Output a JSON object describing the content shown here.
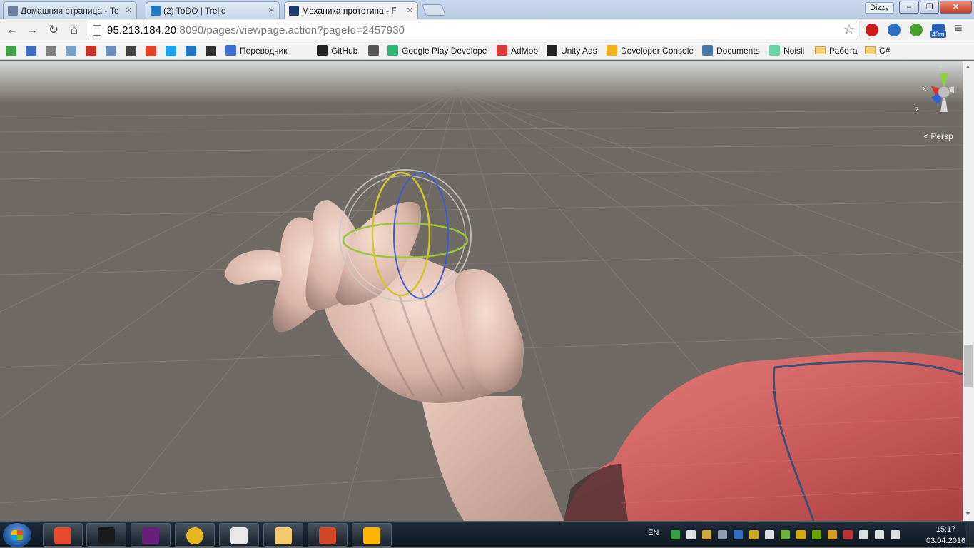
{
  "browser": {
    "tabs": [
      {
        "title": "Домашняя страница - Te",
        "active": false,
        "icon_color": "#6d7fa3"
      },
      {
        "title": "(2) ToDO | Trello",
        "active": false,
        "icon_color": "#1f78c1"
      },
      {
        "title": "Механика прототипа - F",
        "active": true,
        "icon_color": "#1d3b6e"
      }
    ],
    "profile_name": "Dizzy",
    "address": {
      "host": "95.213.184.20",
      "rest": ":8090/pages/viewpage.action?pageId=2457930"
    },
    "extensions": [
      {
        "name": "opera-icon",
        "color": "#cc1b1b"
      },
      {
        "name": "itunes-icon",
        "color": "#2a72c8"
      },
      {
        "name": "evernote-icon",
        "color": "#4aa02c"
      },
      {
        "name": "timer-icon",
        "color": "#2860b8",
        "label": "43m"
      },
      {
        "name": "menu-icon",
        "color": "#555555"
      }
    ],
    "bookmarks": [
      {
        "label": "Переводчик",
        "color": "#3c6fd1"
      },
      {
        "label": "GitHub",
        "color": "#222222"
      },
      {
        "label": "",
        "color": "#555555"
      },
      {
        "label": "Google Play Develope",
        "color": "#2fb673"
      },
      {
        "label": "AdMob",
        "color": "#e0393c"
      },
      {
        "label": "Unity Ads",
        "color": "#222222"
      },
      {
        "label": "Developer Console",
        "color": "#f2b21b"
      },
      {
        "label": "Documents",
        "color": "#4a76a8"
      },
      {
        "label": "Noisli",
        "color": "#6bd3a8"
      },
      {
        "label": "Работа",
        "folder": true
      },
      {
        "label": "C#",
        "folder": true
      }
    ],
    "bookmark_icons": [
      "#3ea24a",
      "#3f6dbd",
      "#808080",
      "#7aa1c6",
      "#c8322d",
      "#6b8eb6",
      "#444444",
      "#e24329",
      "#1da1f2",
      "#1f78c1",
      "#333333"
    ]
  },
  "scene": {
    "view_label": "Persp",
    "gizmo_axes": {
      "x": "x",
      "y": "y",
      "z": "z"
    }
  },
  "taskbar": {
    "apps": [
      {
        "name": "git-icon",
        "color": "#e6492e"
      },
      {
        "name": "unity-icon",
        "color": "#1b1b1b"
      },
      {
        "name": "visual-studio-icon",
        "color": "#68217a"
      },
      {
        "name": "chrome-icon",
        "color": "#e6b421"
      },
      {
        "name": "slack-icon",
        "color": "#e8e8e8"
      },
      {
        "name": "file-explorer-icon",
        "color": "#f2c96b"
      },
      {
        "name": "powerpoint-icon",
        "color": "#d24726"
      },
      {
        "name": "flash-icon",
        "color": "#ffb400"
      }
    ],
    "language": "EN",
    "tray_colors": [
      "#3db54a",
      "#ffffff",
      "#f0c040",
      "#9fb1c4",
      "#3c7bd0",
      "#f0c020",
      "#ffffff",
      "#7acb3d",
      "#f2c200",
      "#76b900",
      "#f6b323",
      "#d33",
      "#ffffff",
      "#ffffff",
      "#ffffff"
    ],
    "time": "15:17",
    "date": "03.04.2016"
  }
}
